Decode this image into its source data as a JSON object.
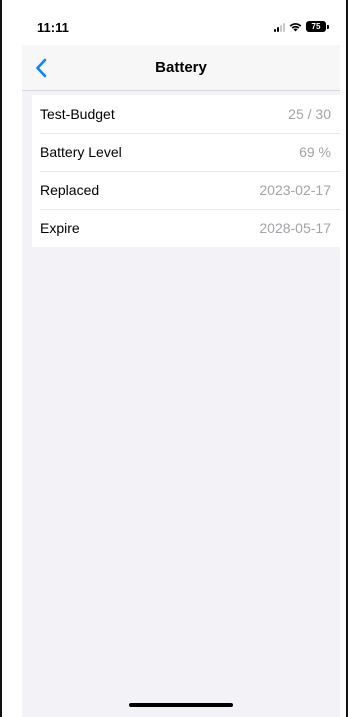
{
  "status_bar": {
    "time": "11:11",
    "battery_percent": "75",
    "icons": [
      "cellular-signal-icon",
      "wifi-icon",
      "battery-icon"
    ]
  },
  "nav": {
    "back_icon": "chevron-left-icon",
    "title": "Battery"
  },
  "rows": [
    {
      "label": "Test-Budget",
      "value": "25 / 30"
    },
    {
      "label": "Battery Level",
      "value": "69 %"
    },
    {
      "label": "Replaced",
      "value": "2023-02-17"
    },
    {
      "label": "Expire",
      "value": "2028-05-17"
    }
  ],
  "colors": {
    "accent": "#0a84ff",
    "background": "#f2f2f7",
    "secondary_text": "#a3a3a8"
  }
}
